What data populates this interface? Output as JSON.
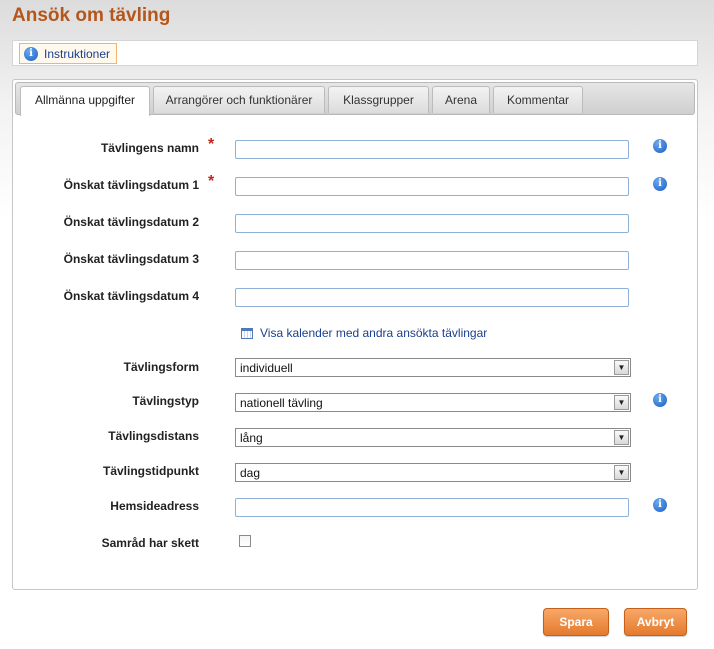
{
  "page": {
    "title": "Ansök om tävling"
  },
  "instructions": {
    "label": "Instruktioner"
  },
  "tabs": [
    {
      "label": "Allmänna uppgifter",
      "active": true
    },
    {
      "label": "Arrangörer och funktionärer"
    },
    {
      "label": "Klassgrupper"
    },
    {
      "label": "Arena"
    },
    {
      "label": "Kommentar"
    }
  ],
  "form": {
    "required_mark": "*",
    "fields": {
      "name": {
        "label": "Tävlingens namn",
        "value": ""
      },
      "date1": {
        "label": "Önskat tävlingsdatum 1",
        "value": ""
      },
      "date2": {
        "label": "Önskat tävlingsdatum 2",
        "value": ""
      },
      "date3": {
        "label": "Önskat tävlingsdatum 3",
        "value": ""
      },
      "date4": {
        "label": "Önskat tävlingsdatum 4",
        "value": ""
      },
      "form": {
        "label": "Tävlingsform",
        "value": "individuell"
      },
      "type": {
        "label": "Tävlingstyp",
        "value": "nationell tävling"
      },
      "distance": {
        "label": "Tävlingsdistans",
        "value": "lång"
      },
      "time": {
        "label": "Tävlingstidpunkt",
        "value": "dag"
      },
      "homepage": {
        "label": "Hemsideadress",
        "value": ""
      },
      "consultation": {
        "label": "Samråd har skett",
        "checked": false
      }
    },
    "calendar_link": "Visa kalender med andra ansökta tävlingar"
  },
  "buttons": {
    "save": "Spara",
    "cancel": "Avbryt"
  },
  "icons": {
    "info": "info-icon",
    "calendar": "calendar-icon",
    "dropdown": "chevron-down-icon"
  },
  "colors": {
    "title": "#b5561a",
    "accent_button": "#e57a2d",
    "link": "#1a3f8f",
    "required": "#c0271d"
  }
}
